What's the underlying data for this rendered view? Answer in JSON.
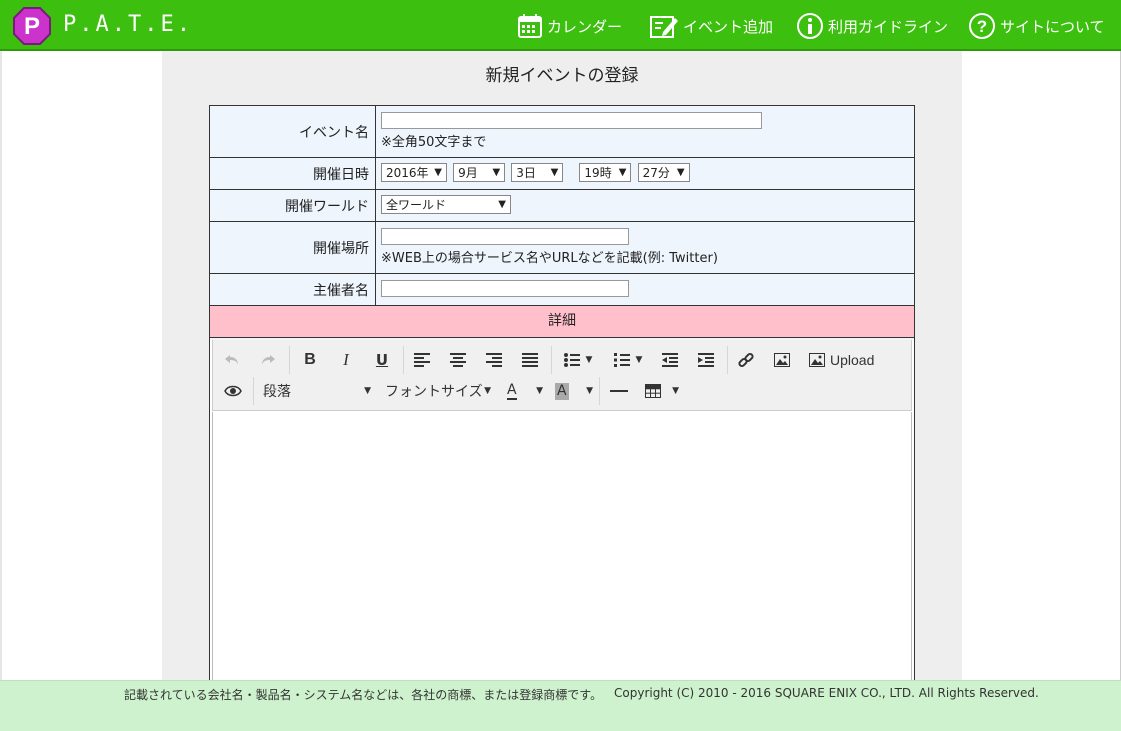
{
  "header": {
    "logo_letter": "P",
    "logo_text": "P.A.T.E.",
    "nav": [
      {
        "label": "カレンダー",
        "icon": "calendar-icon"
      },
      {
        "label": "イベント追加",
        "icon": "edit-icon"
      },
      {
        "label": "利用ガイドライン",
        "icon": "info-icon"
      },
      {
        "label": "サイトについて",
        "icon": "help-icon"
      }
    ],
    "colors": {
      "bar": "#3cbf0f",
      "logo": "#cc33cc"
    }
  },
  "page": {
    "title": "新規イベントの登録"
  },
  "form": {
    "event_name_label": "イベント名",
    "event_name_value": "",
    "event_name_note": "※全角50文字まで",
    "datetime_label": "開催日時",
    "year": "2016年",
    "month": "9月",
    "day": "3日",
    "hour": "19時",
    "minute": "27分",
    "world_label": "開催ワールド",
    "world_value": "全ワールド",
    "place_label": "開催場所",
    "place_value": "",
    "place_note": "※WEB上の場合サービス名やURLなどを記載(例: Twitter)",
    "organizer_label": "主催者名",
    "organizer_value": "",
    "detail_label": "詳細"
  },
  "editor": {
    "upload_label": "Upload",
    "paragraph_label": "段落",
    "fontsize_label": "フォントサイズ",
    "text_color_glyph": "A",
    "bg_color_glyph": "A"
  },
  "footer": {
    "trademark": "記載されている会社名・製品名・システム名などは、各社の商標、または登録商標です。",
    "copyright": "Copyright (C) 2010 - 2016 SQUARE ENIX CO., LTD. All Rights Reserved."
  }
}
